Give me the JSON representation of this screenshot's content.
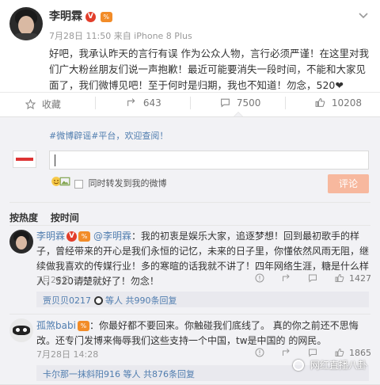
{
  "post": {
    "author": "李明霖",
    "verified_badge": "V",
    "level_badge": "%",
    "meta": "7月28日 11:50 来自 iPhone 8 Plus",
    "body": "好吧，我承认昨天的言行有误 作为公众人物，言行必须严谨！在这里对我们广大粉丝朋友们说一声抱歉！最近可能要消失一段时间，不能和大家见面了，我们微博见吧！至于何时是归期，我也不知道！勿念，520❤"
  },
  "actions": {
    "favorite": "收藏",
    "forward": "643",
    "comment": "7500",
    "like": "10208"
  },
  "comment_panel": {
    "notice_prefix": "#微博辟谣#平台，",
    "notice_link": "欢迎查阅！",
    "repost_label": "同时转发到我的微博",
    "submit_label": "评论",
    "input_value": ""
  },
  "sort_tabs": {
    "hot": "按热度",
    "time": "按时间"
  },
  "comments": [
    {
      "author": "李明霖",
      "mention": "@李明霖",
      "text": "：我的初衷是娱乐大家，追逐梦想！回到最初歌手的样子，曾经带来的开心是我们永恒的记忆，未来的日子里，你懂依然风雨无阻，继续做我喜欢的传媒行业！多的寒暄的话我就不讲了！四年网络生涯，糖是什么样人，520请楚就好了！勿念！",
      "time": "7月28日 14:33",
      "likes": "1427",
      "reply_user": "贾贝贝0217",
      "reply_suffix": "等人 共990条回复"
    },
    {
      "author": "孤煞babi",
      "text": "：你最好都不要回来。你触碰我们底线了。  真的你之前还不思悔改。还专门发博来侮辱我们这些支持一个中国，tw是中国的  的网民。",
      "time": "7月28日 14:28",
      "likes": "1865",
      "reply_user": "卡尔那一抹斜阳916",
      "reply_suffix": "等人 共876条回复"
    }
  ],
  "watermark": "网红直播八卦"
}
